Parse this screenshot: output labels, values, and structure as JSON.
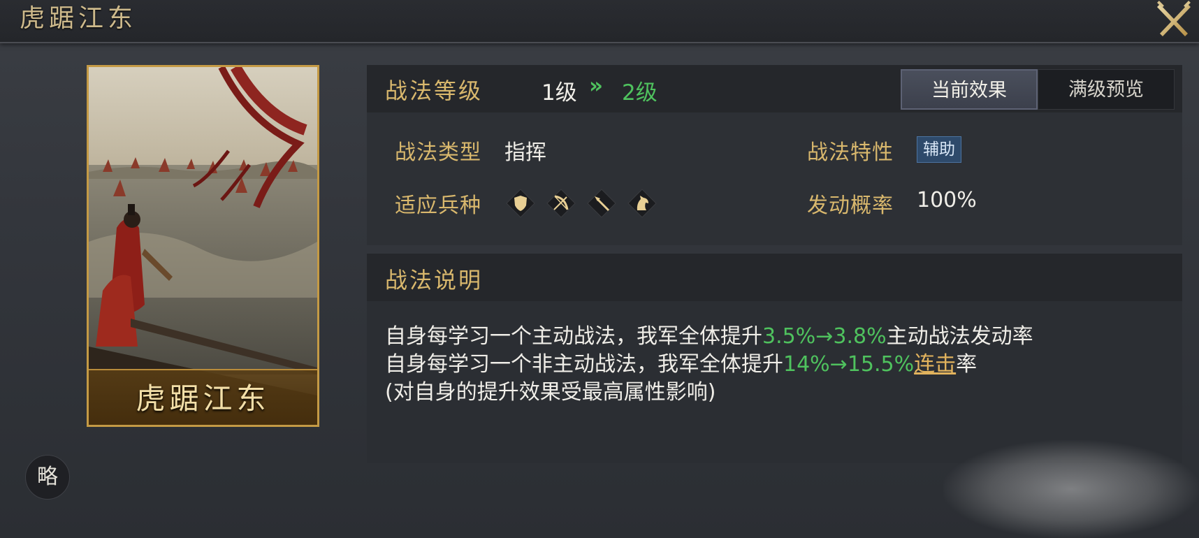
{
  "window": {
    "title": "虎踞江东"
  },
  "card": {
    "name": "虎踞江东"
  },
  "side_button": {
    "label": "略"
  },
  "level": {
    "label": "战法等级",
    "from": "1级",
    "arrow": "»",
    "to": "2级"
  },
  "tabs": [
    {
      "label": "当前效果",
      "active": true
    },
    {
      "label": "满级预览",
      "active": false
    }
  ],
  "attributes": {
    "type_label": "战法类型",
    "type_value": "指挥",
    "trait_label": "战法特性",
    "trait_value": "辅助",
    "troops_label": "适应兵种",
    "troops": [
      "shield-icon",
      "bow-icon",
      "spear-icon",
      "horse-icon"
    ],
    "rate_label": "发动概率",
    "rate_value": "100%"
  },
  "description": {
    "title": "战法说明",
    "line1_a": "自身每学习一个主动战法，我军全体提升",
    "line1_b": "3.5%→3.8%",
    "line1_c": "主动战法发动率",
    "line2_a": "自身每学习一个非主动战法，我军全体提升",
    "line2_b": "14%→15.5%",
    "line2_link": "连击",
    "line2_c": "率",
    "line3": "(对自身的提升效果受最高属性影响)"
  },
  "colors": {
    "gold_label": "#d9b86d",
    "green_value": "#4fc25e",
    "link": "#e2b35d",
    "trait_badge": "#2e4a6b"
  }
}
